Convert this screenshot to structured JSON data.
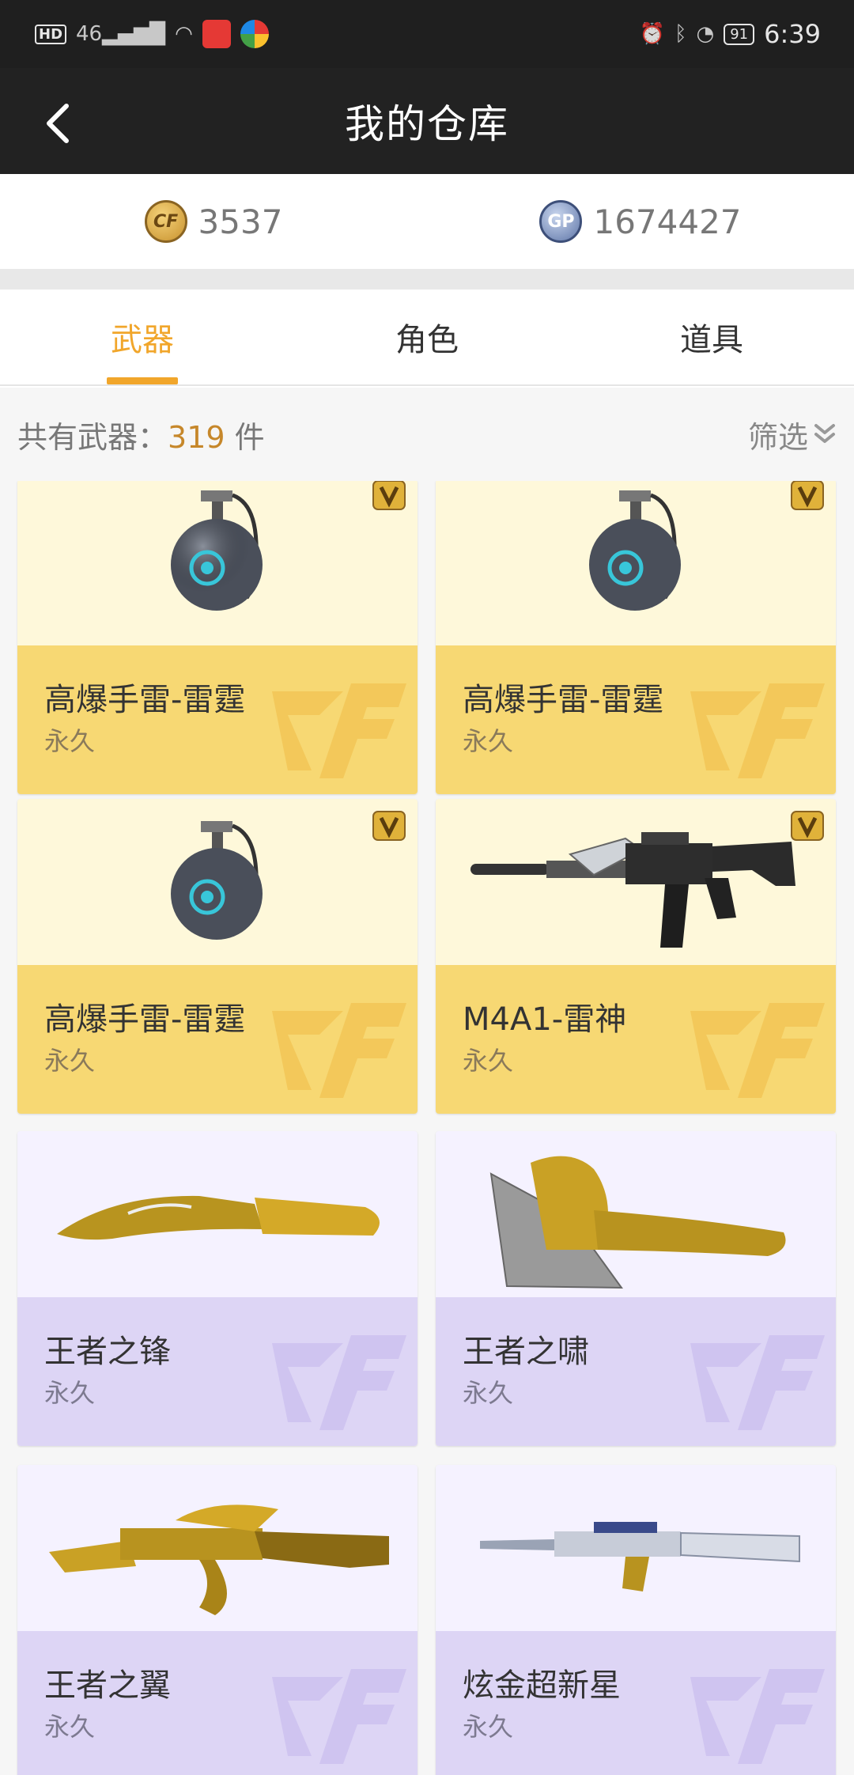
{
  "status_bar": {
    "network": "46",
    "battery": "91",
    "time": "6:39"
  },
  "header": {
    "title": "我的仓库"
  },
  "currency": {
    "cf_points": "3537",
    "gp_points": "1674427",
    "gp_label": "GP",
    "cf_label": "CF"
  },
  "tabs": [
    {
      "label": "武器",
      "active": true
    },
    {
      "label": "角色",
      "active": false
    },
    {
      "label": "道具",
      "active": false
    }
  ],
  "summary": {
    "prefix": "共有武器：",
    "count": "319",
    "suffix": " 件",
    "filter_label": "筛选"
  },
  "items": [
    {
      "name": "高爆手雷-雷霆",
      "duration": "永久",
      "theme": "gold",
      "vip": true,
      "icon": "grenade-icon"
    },
    {
      "name": "高爆手雷-雷霆",
      "duration": "永久",
      "theme": "gold",
      "vip": true,
      "icon": "grenade-icon"
    },
    {
      "name": "高爆手雷-雷霆",
      "duration": "永久",
      "theme": "gold",
      "vip": true,
      "icon": "grenade-icon"
    },
    {
      "name": "M4A1-雷神",
      "duration": "永久",
      "theme": "gold",
      "vip": true,
      "icon": "rifle-icon"
    },
    {
      "name": "王者之锋",
      "duration": "永久",
      "theme": "purple",
      "vip": false,
      "icon": "knife-icon"
    },
    {
      "name": "王者之啸",
      "duration": "永久",
      "theme": "purple",
      "vip": false,
      "icon": "axe-icon"
    },
    {
      "name": "王者之翼",
      "duration": "永久",
      "theme": "purple",
      "vip": false,
      "icon": "rifle-icon"
    },
    {
      "name": "炫金超新星",
      "duration": "永久",
      "theme": "purple",
      "vip": false,
      "icon": "rifle-icon"
    }
  ],
  "colors": {
    "accent": "#f1a62b",
    "gold_info": "#f7d873",
    "purple_info": "#ddd5f5"
  }
}
